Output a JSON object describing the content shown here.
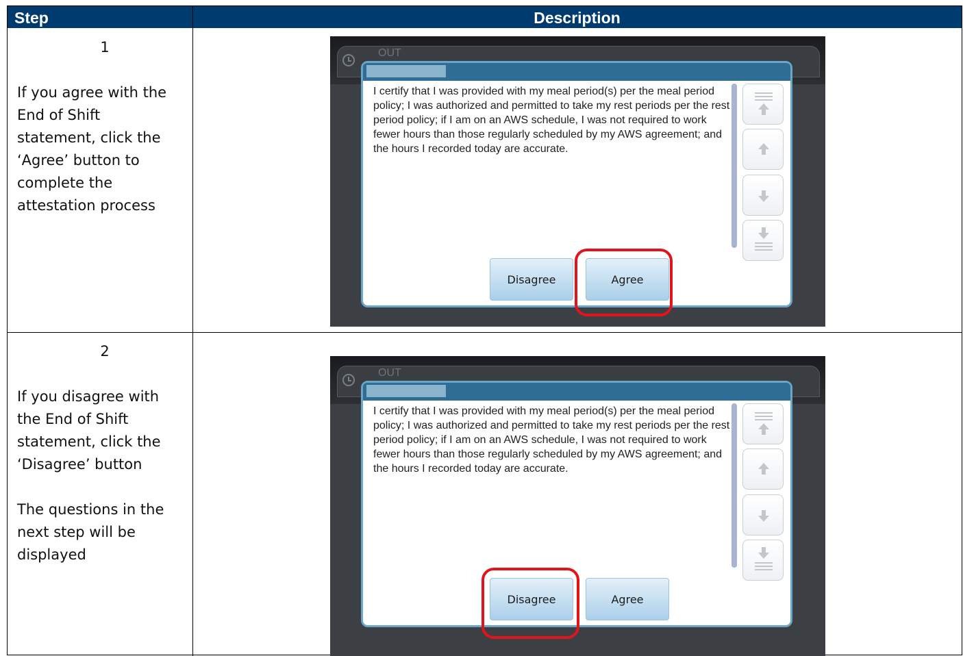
{
  "table": {
    "header_step": "Step",
    "header_description": "Description"
  },
  "steps": [
    {
      "number": "1",
      "paragraphs": [
        "If you agree with the End of Shift statement, click the ‘Agree’ button to complete the attestation process"
      ],
      "highlighted_button": "Agree"
    },
    {
      "number": "2",
      "paragraphs": [
        "If you disagree with the End of Shift statement, click the ‘Disagree’ button",
        "The questions in the next step will be displayed"
      ],
      "highlighted_button": "Disagree"
    }
  ],
  "device": {
    "status_label": "OUT",
    "statement": "I certify that I was provided with my meal period(s) per the meal period policy; I was authorized and permitted to take my rest periods per the rest period policy; if I am on an AWS schedule, I was not required to work fewer hours than those regularly scheduled by my AWS agreement; and the hours I recorded today are accurate.",
    "disagree_label": "Disagree",
    "agree_label": "Agree"
  },
  "colors": {
    "header_bg": "#003b70",
    "highlight": "#e2141b",
    "dialog_title": "#2f6d94"
  }
}
